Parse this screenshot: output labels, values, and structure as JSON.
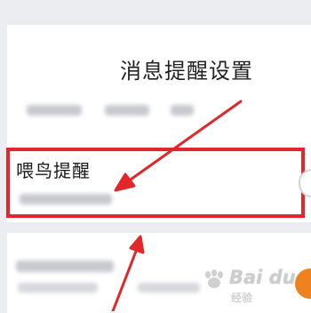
{
  "page": {
    "heading": "消息提醒设置"
  },
  "highlighted_item": {
    "title": "喂鸟提醒",
    "toggle_state": "off"
  },
  "annotation": {
    "highlight_color": "#e2262a",
    "arrow_color": "#e2262a"
  },
  "watermark": {
    "brand": "Bai du",
    "sub": "经验"
  },
  "colors": {
    "background": "#ecedf1",
    "card": "#ffffff",
    "accent_orange": "#f0821e"
  }
}
